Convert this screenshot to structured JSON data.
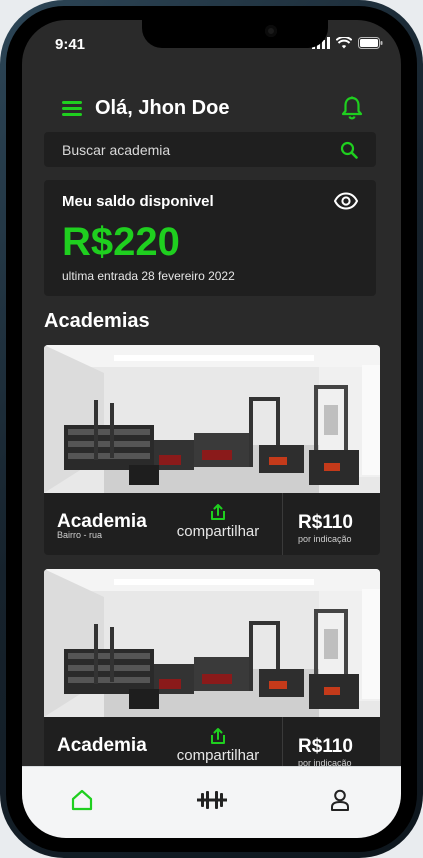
{
  "status_bar": {
    "time": "9:41"
  },
  "header": {
    "greeting": "Olá, Jhon Doe"
  },
  "search": {
    "placeholder": "Buscar academia"
  },
  "balance": {
    "title": "Meu saldo disponivel",
    "amount": "R$220",
    "note": "ultima entrada 28 fevereiro 2022"
  },
  "section": {
    "title": "Academias"
  },
  "gyms": [
    {
      "name": "Academia",
      "location": "Bairro - rua",
      "share_label": "compartilhar",
      "price": "R$110",
      "price_note": "por indicação"
    },
    {
      "name": "Academia",
      "location": "",
      "share_label": "compartilhar",
      "price": "R$110",
      "price_note": "por indicação"
    }
  ],
  "icons": {
    "menu": "menu-icon",
    "bell": "bell-icon",
    "search": "search-icon",
    "eye": "eye-icon",
    "share": "share-icon",
    "home": "home-icon",
    "workout": "dumbbell-icon",
    "profile": "user-icon"
  },
  "colors": {
    "accent": "#1fcf1f",
    "background": "#2a2a2a",
    "card": "#1f1f1f",
    "tabbar": "#f4f5f6"
  }
}
